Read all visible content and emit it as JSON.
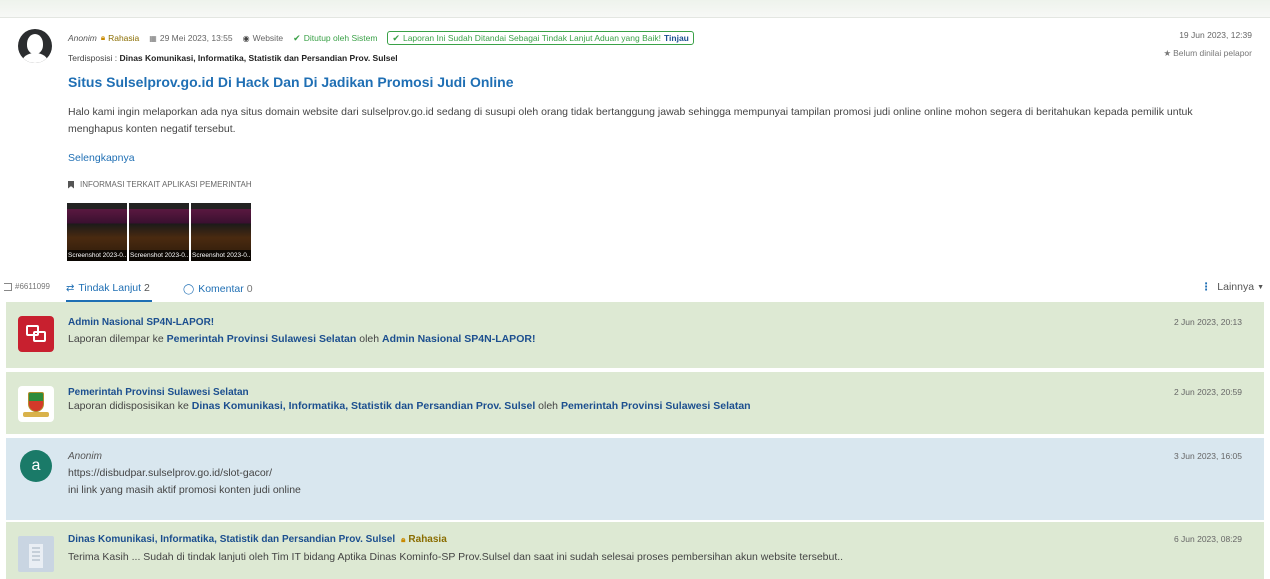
{
  "report": {
    "author": "Anonim",
    "privacy": "Rahasia",
    "date": "29 Mei 2023, 13:55",
    "channel": "Website",
    "closed_status": "Ditutup oleh Sistem",
    "badge_text": "Laporan Ini Sudah Ditandai Sebagai Tindak Lanjut Aduan yang Baik!",
    "badge_link": "Tinjau",
    "disposisi_label": "Terdisposisi :",
    "disposisi_value": "Dinas Komunikasi, Informatika, Statistik dan Persandian Prov. Sulsel",
    "title": "Situs Sulselprov.go.id Di Hack Dan Di Jadikan Promosi Judi Online",
    "description": "Halo kami ingin melaporkan ada nya situs domain website dari sulselprov.go.id sedang di susupi oleh orang tidak bertanggung jawab sehingga mempunyai tampilan promosi judi online online mohon segera di beritahukan kepada pemilik untuk menghapus konten negatif tersebut.",
    "more_link": "Selengkapnya",
    "info_label": "INFORMASI TERKAIT APLIKASI PEMERINTAH",
    "attachments": [
      {
        "caption": "Screenshot 2023-0..."
      },
      {
        "caption": "Screenshot 2023-0..."
      },
      {
        "caption": "Screenshot 2023-0..."
      }
    ],
    "timestamp": "19 Jun 2023, 12:39",
    "rating": "Belum dinilai pelapor"
  },
  "tabs": {
    "report_id": "#6611099",
    "tindak_lanjut_label": "Tindak Lanjut",
    "tindak_lanjut_count": "2",
    "komentar_label": "Komentar",
    "komentar_count": "0",
    "more_label": "Lainnya"
  },
  "timeline": [
    {
      "who": "Admin Nasional SP4N-LAPOR!",
      "text_pre": "Laporan dilempar ke ",
      "link1": "Pemerintah Provinsi Sulawesi Selatan",
      "text_mid": " oleh ",
      "link2": "Admin Nasional SP4N-LAPOR!",
      "time": "2 Jun 2023, 20:13"
    },
    {
      "who": "Pemerintah Provinsi Sulawesi Selatan",
      "text_pre": "Laporan didisposisikan ke ",
      "link1": "Dinas Komunikasi, Informatika, Statistik dan Persandian Prov. Sulsel",
      "text_mid": " oleh ",
      "link2": "Pemerintah Provinsi Sulawesi Selatan",
      "time": "2 Jun 2023, 20:59"
    },
    {
      "avatar_letter": "a",
      "who": "Anonim",
      "line1": "https://disbudpar.sulselprov.go.id/slot-gacor/",
      "line2": "ini link yang masih aktif promosi konten judi online",
      "time": "3 Jun 2023, 16:05"
    },
    {
      "who": "Dinas Komunikasi, Informatika, Statistik dan Persandian Prov. Sulsel",
      "privacy": "Rahasia",
      "text": "Terima Kasih ... Sudah di tindak lanjuti oleh Tim IT bidang Aptika Dinas Kominfo-SP Prov.Sulsel dan saat ini sudah selesai proses pembersihan akun website tersebut..",
      "time": "6 Jun 2023, 08:29"
    }
  ],
  "colors": {
    "link_blue": "#1f6fb4",
    "name_blue": "#1c4f8f",
    "success_green": "#3aa147",
    "row_green": "#dde9d3",
    "row_blue": "#d9e7ef",
    "lapor_red": "#c8202f"
  }
}
